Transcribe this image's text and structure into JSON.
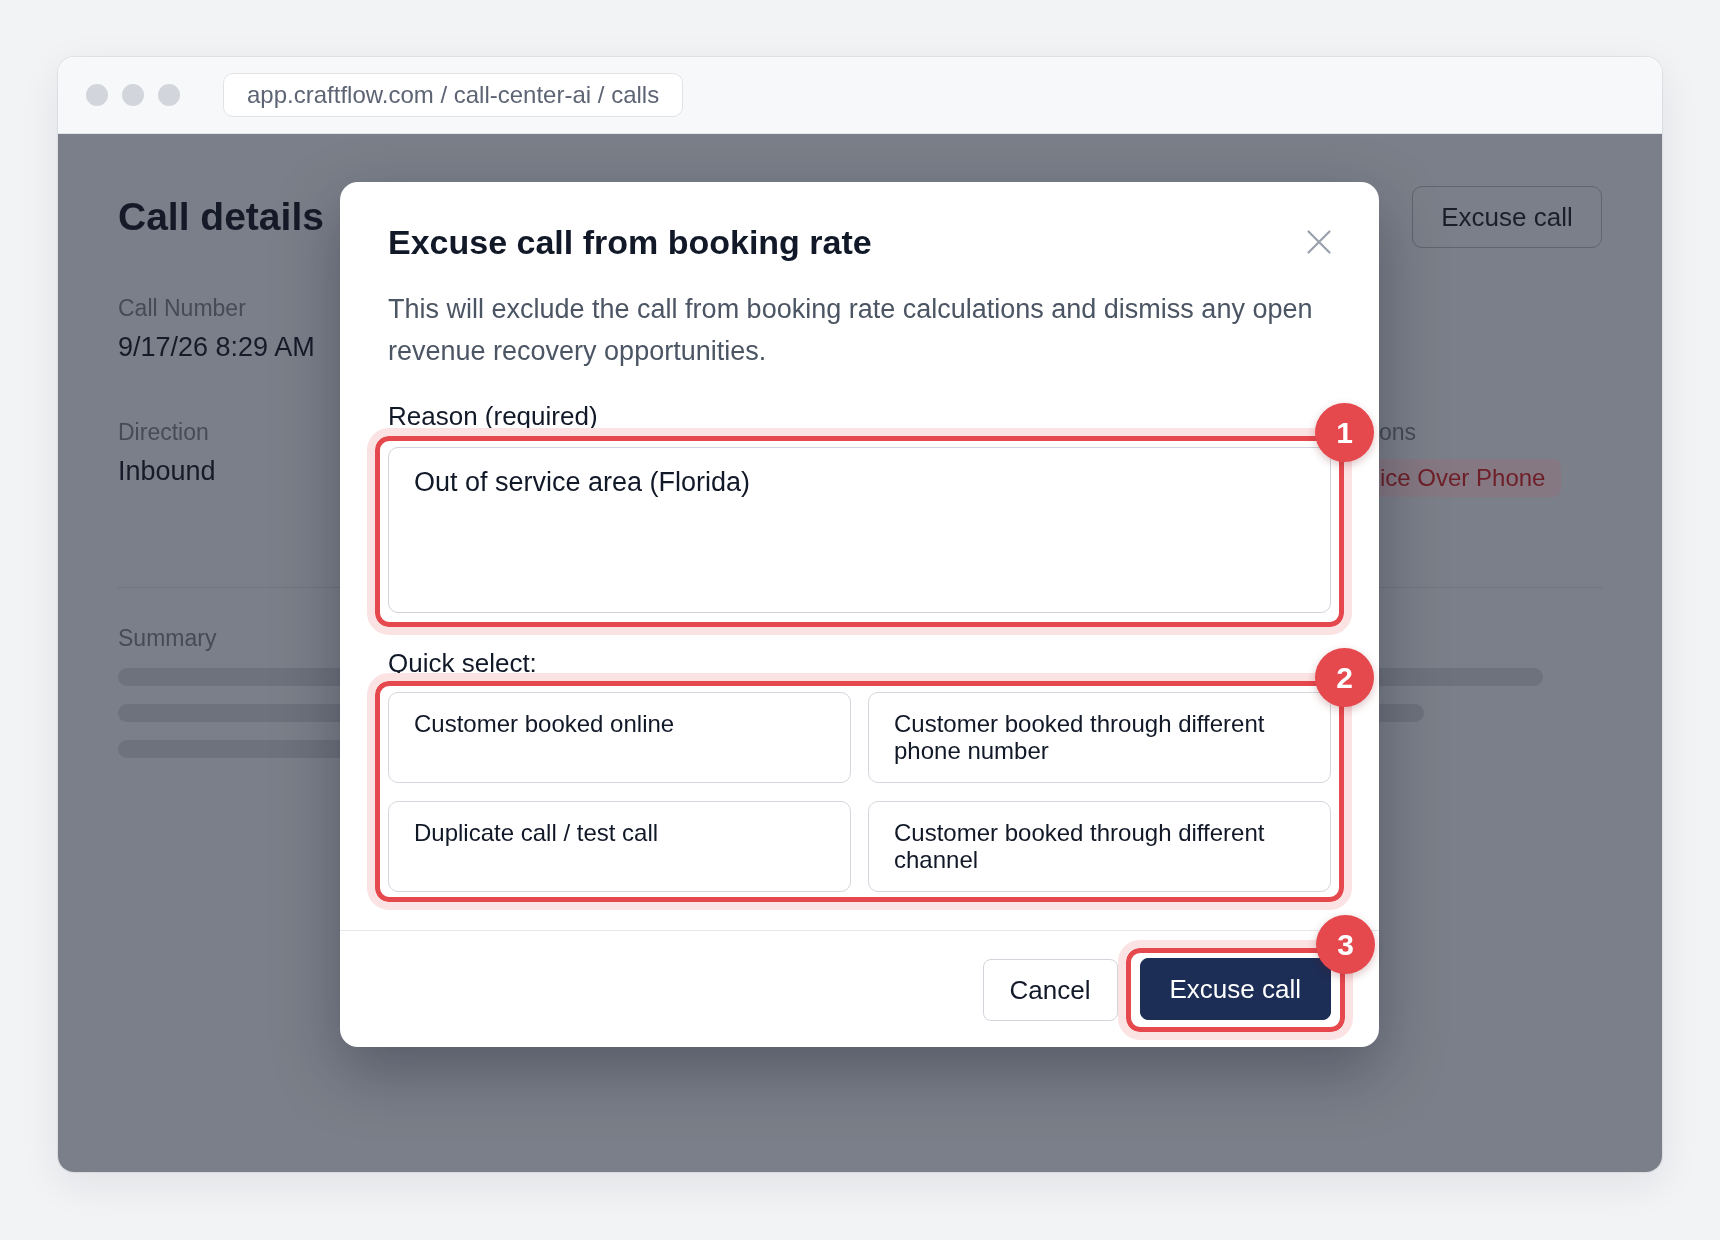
{
  "browser": {
    "address": "app.craftflow.com / call-center-ai / calls"
  },
  "page": {
    "title": "Call details",
    "action_button": "Excuse call",
    "fields": [
      {
        "label": "Call Number",
        "value": "9/17/26 8:29 AM"
      },
      {
        "label": "Direction",
        "value": "Inbound"
      }
    ],
    "side_field": {
      "label": "ons",
      "tag": "ice Over Phone"
    },
    "section_label": "Summary"
  },
  "dialog": {
    "title": "Excuse call from booking rate",
    "description": "This will exclude the call from booking rate calculations and dismiss any open revenue recovery opportunities.",
    "reason": {
      "label": "Reason (required)",
      "value": "Out of service area (Florida)",
      "callout": "1"
    },
    "quick_select": {
      "label": "Quick select:",
      "callout": "2",
      "options": [
        "Customer booked online",
        "Customer booked through different phone number",
        "Duplicate call / test call",
        "Customer booked through different channel"
      ]
    },
    "buttons": [
      {
        "label": "Cancel",
        "kind": "secondary"
      },
      {
        "label": "Excuse call",
        "kind": "primary",
        "callout": "3"
      }
    ]
  }
}
